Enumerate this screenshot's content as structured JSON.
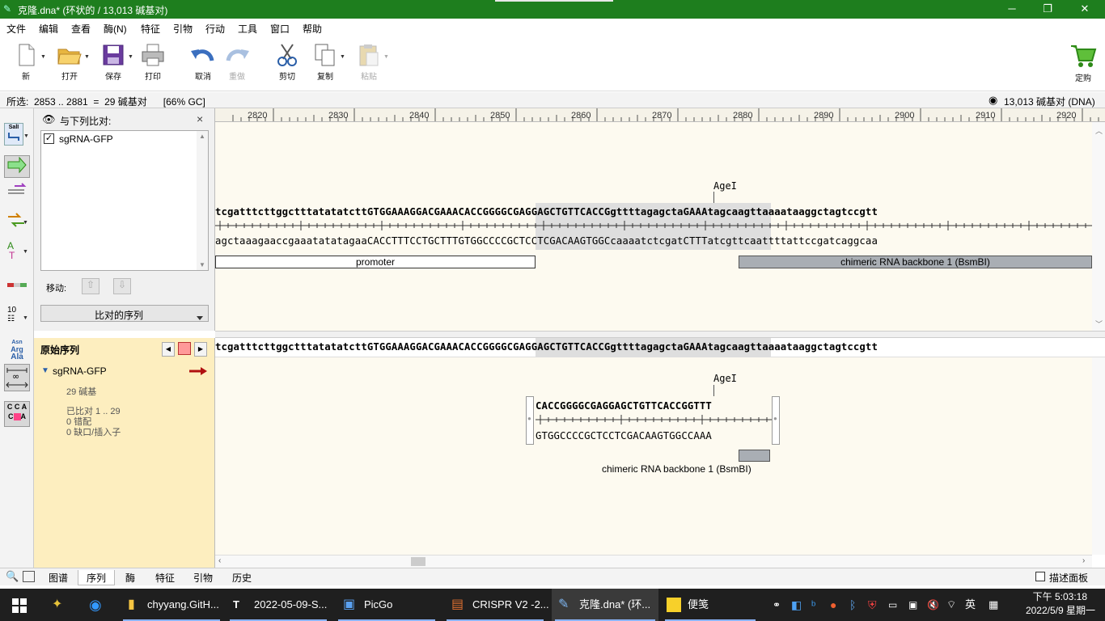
{
  "window": {
    "title": "克隆.dna*  (环状的 / 13,013 碱基对)",
    "buttons": {
      "minimize": "─",
      "restore": "❐",
      "close": "✕"
    }
  },
  "menu": [
    "文件",
    "编辑",
    "查看",
    "酶(N)",
    "特征",
    "引物",
    "行动",
    "工具",
    "窗口",
    "帮助"
  ],
  "toolbar": {
    "new": "新",
    "open": "打开",
    "save": "保存",
    "print": "打印",
    "undo": "取消",
    "redo": "重做",
    "cut": "剪切",
    "copy": "复制",
    "paste": "粘贴",
    "order": "定购"
  },
  "status": {
    "selection": "所选:  2853 .. 2881  =  29 碱基对      [66% GC]",
    "length": "13,013 碱基对  (DNA)"
  },
  "sidebar_tools": {
    "sall": "SalI",
    "numbers": "10",
    "aa_asn": "Asn",
    "aa_arg": "Arg",
    "aa_ala": "Ala",
    "cca": "C C A",
    "cca2": "C",
    "cca3": "A"
  },
  "align_panel": {
    "header": "与下列比对:",
    "close": "×",
    "items": [
      {
        "label": "sgRNA-GFP",
        "checked": true
      }
    ],
    "move_label": "移动:",
    "dropdown": "比对的序列"
  },
  "orig_panel": {
    "title": "原始序列",
    "seq_name": "sgRNA-GFP",
    "length": "29 碱基",
    "aligned": "已比对  1 .. 29",
    "mismatch": "0 错配",
    "gaps": "0 缺口/插入子"
  },
  "ruler": {
    "ticks": [
      "2820",
      "2830",
      "2840",
      "2850",
      "2860",
      "2870",
      "2880",
      "2890",
      "2900",
      "2910",
      "2920"
    ]
  },
  "sequence": {
    "top_strand": "tcgatttcttggctttatatatcttGTGGAAAGGACGAAACACCGGGGCGAGGAGCTGTTCACCGgttttagagctaGAAAtagcaagttaaaataaggctagtccgtt",
    "bottom_strand": "agctaaagaaccgaaatatatagaaCACCTTTCCTGCTTTGTGGCCCCGCTCCTCGACAAGTGGCcaaaatctcgatCTTTatcgttcaattttattccgatcaggcaa",
    "site_label": "AgeI",
    "features": [
      {
        "name": "promoter",
        "color": "#ffffff"
      },
      {
        "name": "chimeric RNA backbone 1 (BsmBI)",
        "color": "#a9aeb4"
      }
    ]
  },
  "reference_line": "tcgatttcttggctttatatatcttGTGGAAAGGACGAAACACCGGGGCGAGGAGCTGTTCACCGgttttagagctaGAAAtagcaagttaaaataaggctagtccgtt",
  "aligned_block": {
    "site_label": "AgeI",
    "top": "CACCGGGGCGAGGAGCTGTTCACCGGTTT",
    "bottom": "GTGGCCCCGCTCCTCGACAAGTGGCCAAA",
    "feature": "chimeric RNA backbone 1 (BsmBI)"
  },
  "bottom_tabs": [
    "图谱",
    "序列",
    "酶",
    "特征",
    "引物",
    "历史"
  ],
  "active_tab": "序列",
  "description_panel": "描述面板",
  "taskbar": {
    "apps": [
      "chyyang.GitH...",
      "2022-05-09-S...",
      "PicGo",
      "CRISPR V2 -2...",
      "克隆.dna* (环...",
      "便笺"
    ],
    "ime": "英",
    "time": "下午 5:03:18",
    "date": "2022/5/9 星期一"
  },
  "colors": {
    "titlebar": "#1e7e1e",
    "highlight": "#dedede",
    "feature_grey": "#a9aeb4",
    "panel_yellow": "#fdeebf"
  }
}
